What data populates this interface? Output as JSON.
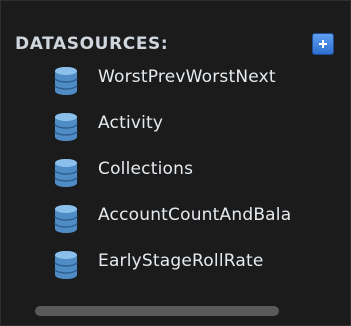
{
  "panel": {
    "header": "DATASOURCES:",
    "add_button_icon": "plus-icon",
    "accent_color": "#3f86e8",
    "icon_color": "#5b9bd6",
    "items": [
      {
        "label": "WorstPrevWorstNext",
        "icon": "database-icon"
      },
      {
        "label": "Activity",
        "icon": "database-icon"
      },
      {
        "label": "Collections",
        "icon": "database-icon"
      },
      {
        "label": "AccountCountAndBala",
        "icon": "database-icon"
      },
      {
        "label": "EarlyStageRollRate",
        "icon": "database-icon"
      }
    ]
  }
}
